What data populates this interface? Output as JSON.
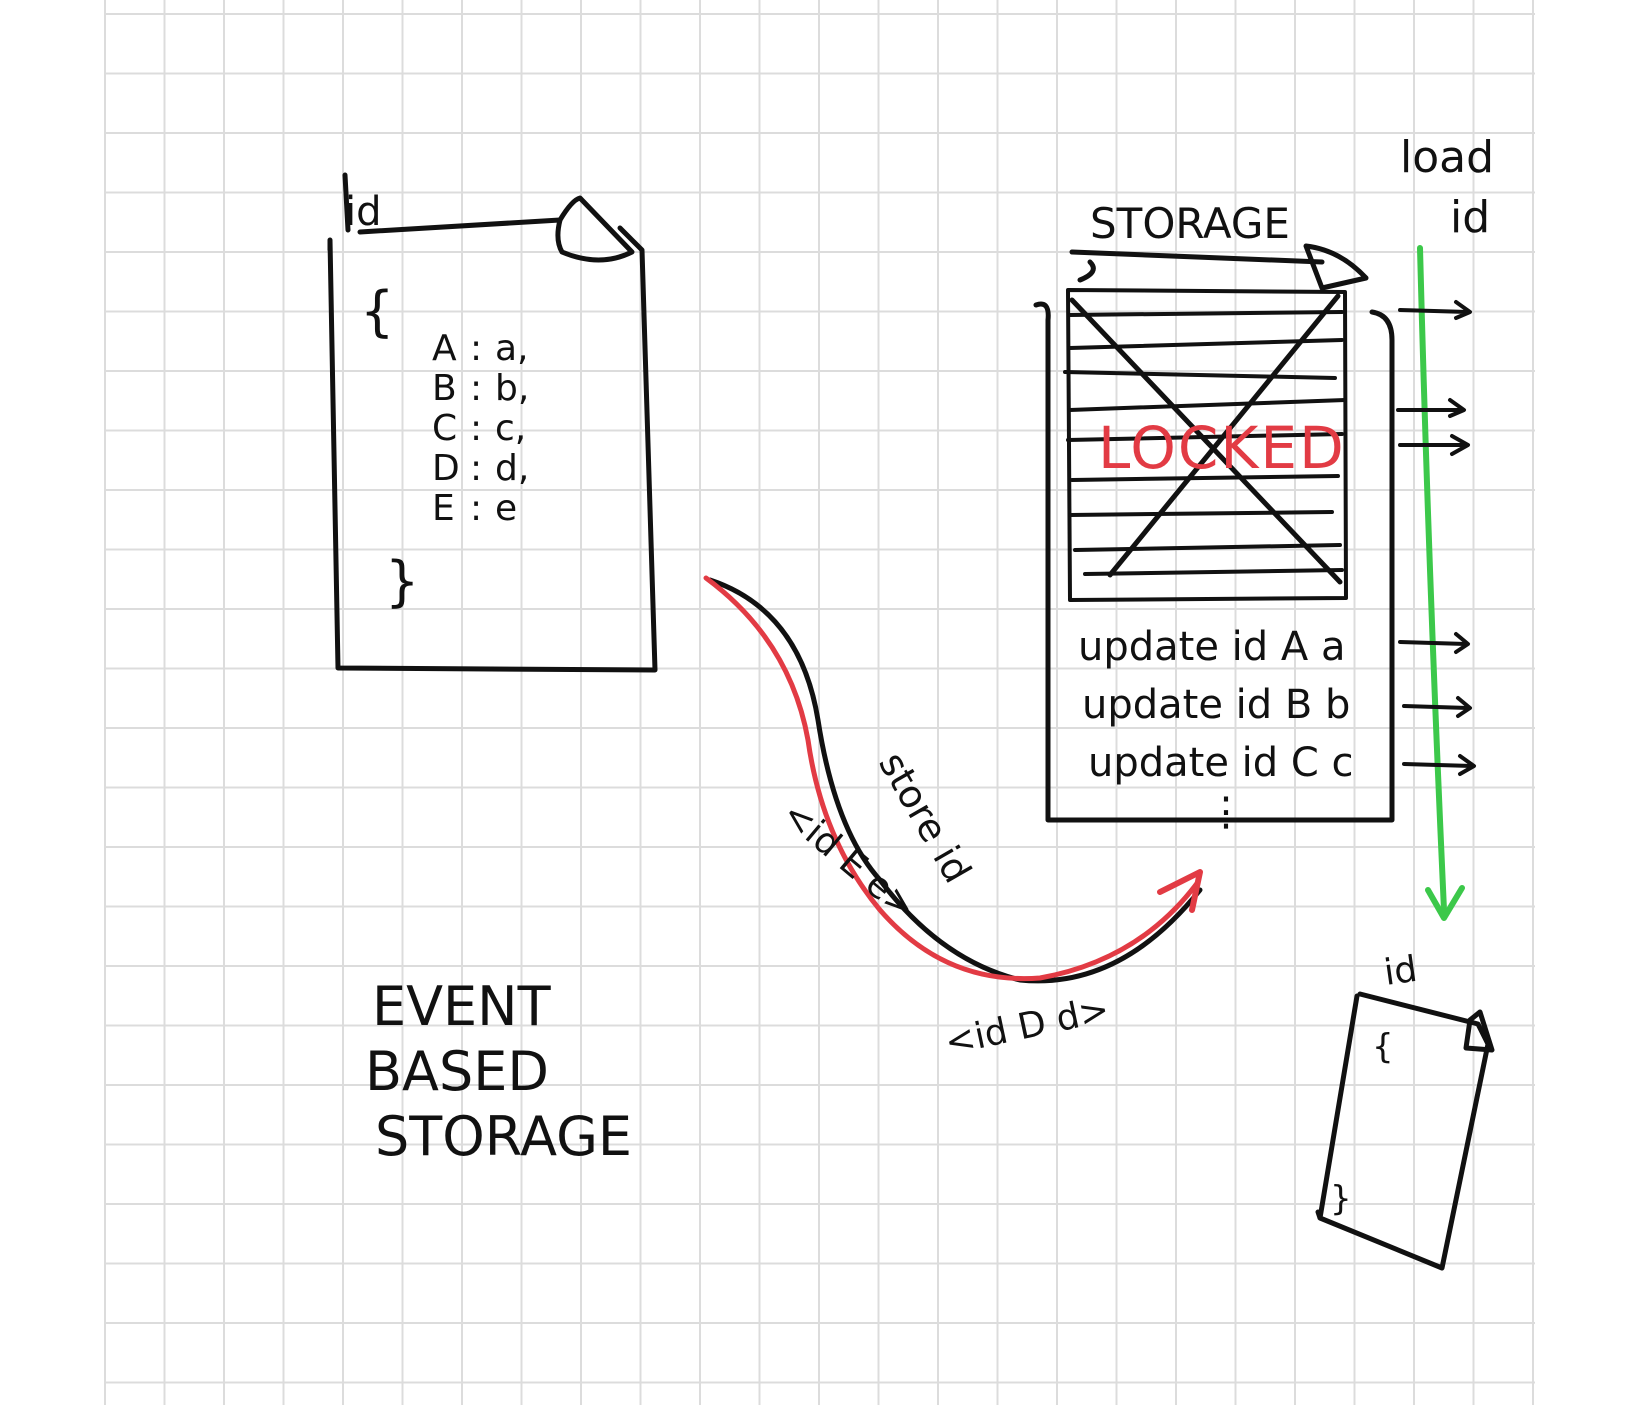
{
  "colors": {
    "ink": "#111111",
    "red": "#e23b44",
    "green": "#3cc84a",
    "grid": "#dcdcdc"
  },
  "document": {
    "id_label": "id",
    "open_brace": "{",
    "fields": [
      {
        "key": "A",
        "sep": ":",
        "value": "a,"
      },
      {
        "key": "B",
        "sep": ":",
        "value": "b,"
      },
      {
        "key": "C",
        "sep": ":",
        "value": "c,"
      },
      {
        "key": "D",
        "sep": ":",
        "value": "d,"
      },
      {
        "key": "E",
        "sep": ":",
        "value": "e"
      }
    ],
    "close_brace": "}"
  },
  "storage": {
    "title": "STORAGE",
    "locked_label": "LOCKED",
    "events": [
      "update id A a",
      "update id B b",
      "update id C c"
    ],
    "more": "⋮"
  },
  "load": {
    "line1": "load",
    "line2": "id"
  },
  "arrow": {
    "store_label": "store id",
    "event_e": "<id E e>",
    "event_d": "<id D d>"
  },
  "result_doc": {
    "id_label": "id",
    "open_brace": "{",
    "close_brace": "}"
  },
  "caption": {
    "line1": "EVENT",
    "line2": "BASED",
    "line3": "STORAGE"
  }
}
